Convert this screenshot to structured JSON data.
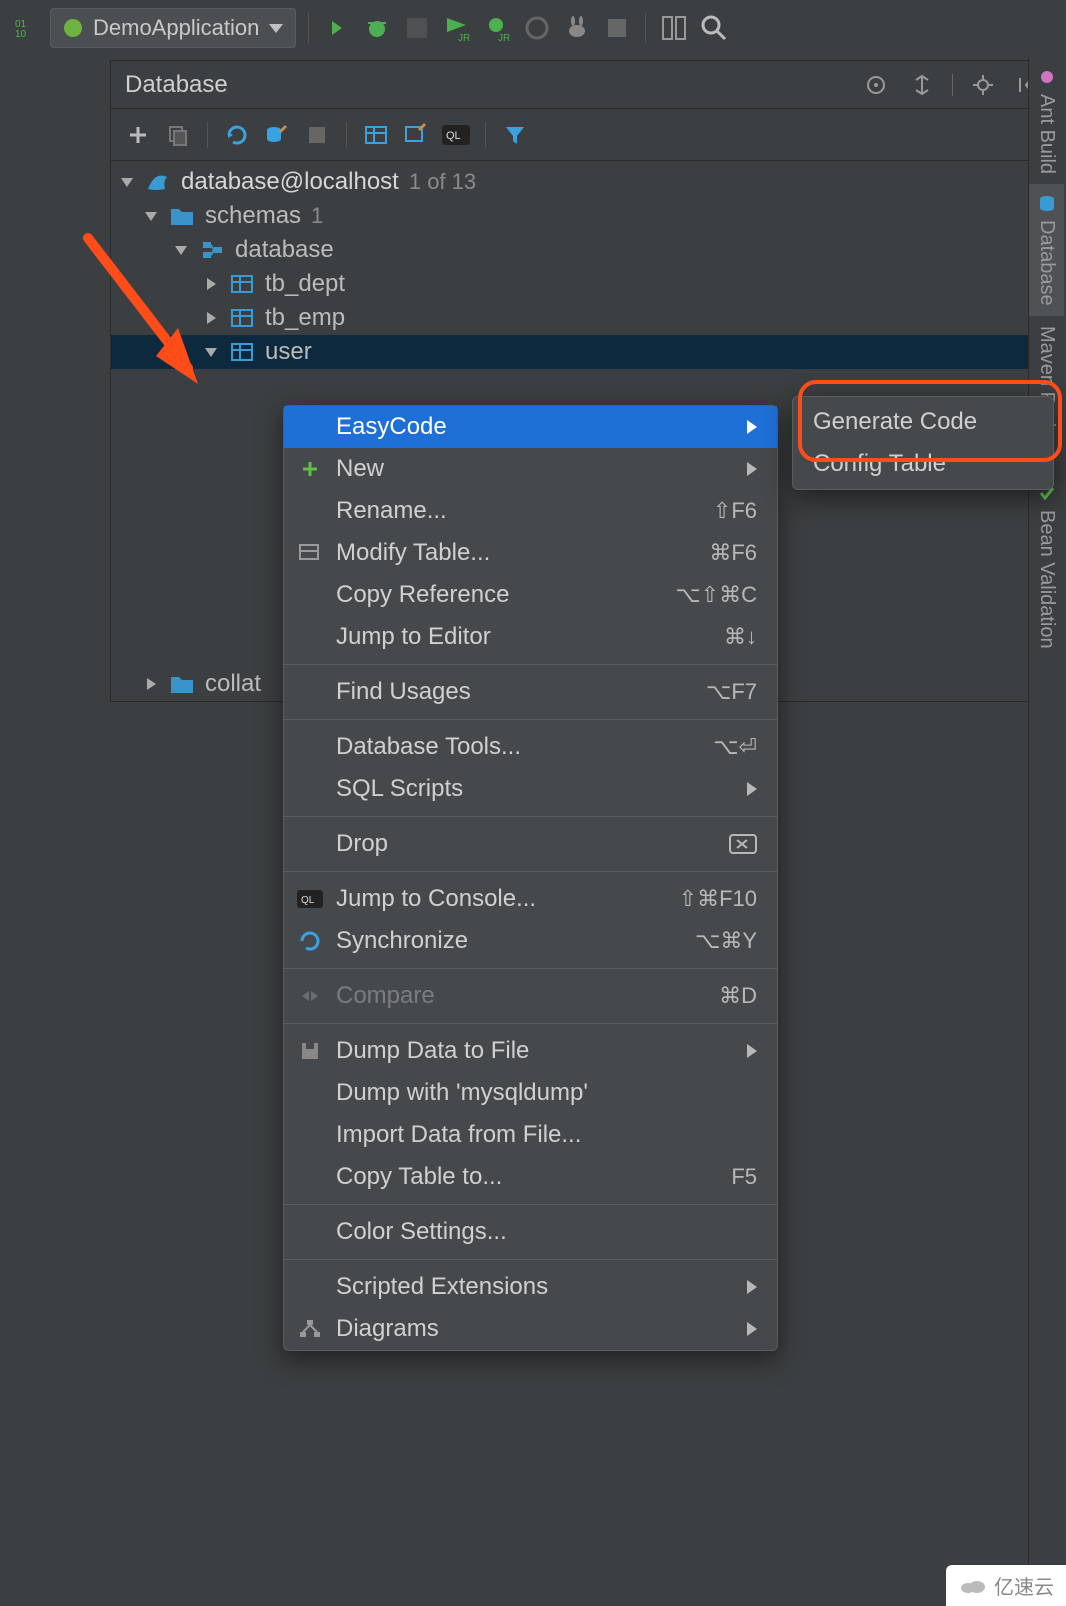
{
  "toolbar": {
    "run_config": "DemoApplication"
  },
  "panel": {
    "title": "Database"
  },
  "tree": {
    "datasource": "database@localhost",
    "datasource_meta": "1 of 13",
    "schemas_label": "schemas",
    "schemas_count": "1",
    "schema_name": "database",
    "tables": [
      "tb_dept",
      "tb_emp",
      "user"
    ],
    "collations_label": "collat"
  },
  "context_menu": {
    "items": [
      {
        "label": "EasyCode",
        "submenu": true,
        "highlight": true
      },
      {
        "label": "New",
        "submenu": true,
        "icon": "plus"
      },
      {
        "label": "Rename...",
        "shortcut": "⇧F6"
      },
      {
        "label": "Modify Table...",
        "shortcut": "⌘F6",
        "icon": "table-edit"
      },
      {
        "label": "Copy Reference",
        "shortcut": "⌥⇧⌘C"
      },
      {
        "label": "Jump to Editor",
        "shortcut": "⌘↓"
      }
    ],
    "group2": [
      {
        "label": "Find Usages",
        "shortcut": "⌥F7"
      }
    ],
    "group3": [
      {
        "label": "Database Tools...",
        "shortcut": "⌥⏎"
      },
      {
        "label": "SQL Scripts",
        "submenu": true
      }
    ],
    "group4": [
      {
        "label": "Drop",
        "shortcut_icon": "delete"
      }
    ],
    "group5": [
      {
        "label": "Jump to Console...",
        "shortcut": "⇧⌘F10",
        "icon": "console"
      },
      {
        "label": "Synchronize",
        "shortcut": "⌥⌘Y",
        "icon": "refresh"
      }
    ],
    "group6": [
      {
        "label": "Compare",
        "shortcut": "⌘D",
        "disabled": true,
        "icon": "compare"
      }
    ],
    "group7": [
      {
        "label": "Dump Data to File",
        "submenu": true,
        "icon": "save"
      },
      {
        "label": "Dump with 'mysqldump'"
      },
      {
        "label": "Import Data from File..."
      },
      {
        "label": "Copy Table to...",
        "shortcut": "F5"
      }
    ],
    "group8": [
      {
        "label": "Color Settings..."
      }
    ],
    "group9": [
      {
        "label": "Scripted Extensions",
        "submenu": true
      },
      {
        "label": "Diagrams",
        "submenu": true,
        "icon": "diagram"
      }
    ]
  },
  "submenu": {
    "items": [
      "Generate Code",
      "Config Table"
    ]
  },
  "side_tabs": {
    "ant": "Ant Build",
    "database": "Database",
    "maven": "Maven Projects",
    "bean": "Bean Validation"
  },
  "watermark": "亿速云"
}
